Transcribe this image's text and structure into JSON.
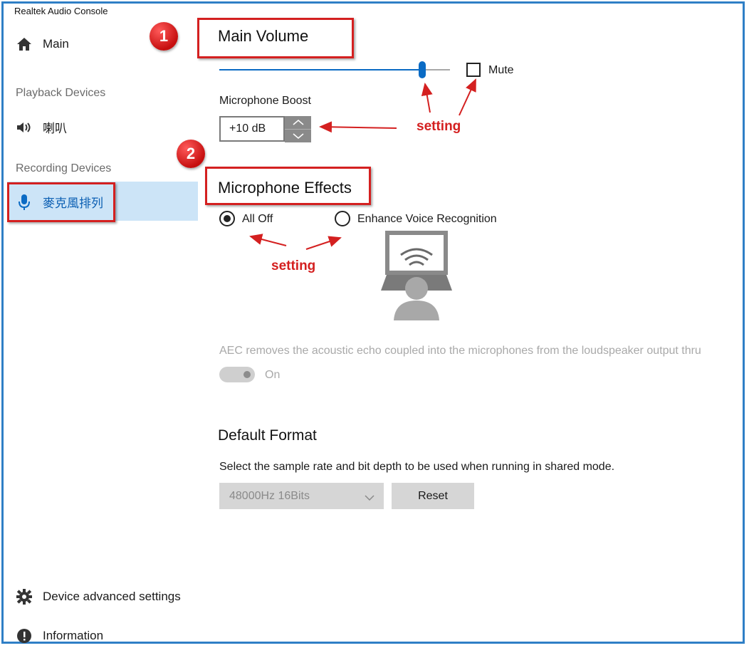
{
  "app": {
    "title": "Realtek Audio Console"
  },
  "sidebar": {
    "main_label": "Main",
    "playback_section": "Playback Devices",
    "playback_device": "喇叭",
    "recording_section": "Recording Devices",
    "recording_device": "麥克風排列",
    "device_advanced": "Device advanced settings",
    "information": "Information"
  },
  "main_volume": {
    "title": "Main Volume",
    "level_fraction": 0.88,
    "mute_label": "Mute",
    "mute_checked": false
  },
  "mic_boost": {
    "label": "Microphone Boost",
    "value": "+10 dB"
  },
  "mic_effects": {
    "title": "Microphone Effects",
    "options": [
      {
        "label": "All Off",
        "selected": true
      },
      {
        "label": "Enhance Voice Recognition",
        "selected": false
      }
    ]
  },
  "aec": {
    "description": "AEC removes the acoustic echo coupled into the microphones from the loudspeaker output thru",
    "toggle_label": "On"
  },
  "default_format": {
    "title": "Default Format",
    "description": "Select the sample rate and bit depth to be used when running in shared mode.",
    "selected": "48000Hz 16Bits",
    "reset_label": "Reset"
  },
  "annotations": {
    "badge_1": "1",
    "badge_2": "2",
    "setting_1": "setting",
    "setting_2": "setting",
    "accent_color": "#d42020"
  },
  "colors": {
    "accent": "#0b6bc4",
    "frame": "#2f7fc6",
    "selected_bg": "#cce4f7"
  }
}
